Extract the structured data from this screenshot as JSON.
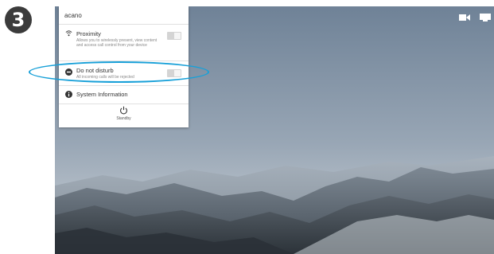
{
  "step_number": "3",
  "panel": {
    "title": "acano",
    "rows": [
      {
        "icon": "wifi-icon",
        "label": "Proximity",
        "description": "Allows you to wirelessly present, view content and access call control from your device",
        "toggle_on": false
      },
      {
        "icon": "do-not-disturb-icon",
        "label": "Do not disturb",
        "description": "All incoming calls will be rejected",
        "toggle_on": false
      },
      {
        "icon": "info-icon",
        "label": "System Information"
      }
    ],
    "standby_label": "Standby"
  },
  "top_icons": [
    "camera-icon",
    "display-icon"
  ],
  "colors": {
    "highlight": "#18a0d8"
  }
}
